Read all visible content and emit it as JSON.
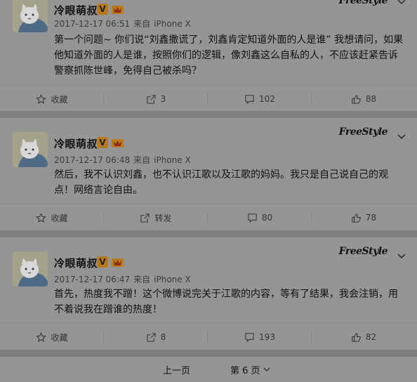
{
  "posts": [
    {
      "username": "冷眼萌叔",
      "timestamp": "2017-12-17 06:51",
      "source_prefix": "来自",
      "source": "iPhone X",
      "brand": "FreeStyle",
      "content": "第一个问题~ 你们说“刘鑫撒谎了，刘鑫肯定知道外面的人是谁” 我想请问，如果他知道外面的人是谁，按照你们的逻辑，像刘鑫这么自私的人，不应该赶紧告诉警察抓陈世峰，免得自己被杀吗？",
      "favorite_label": "收藏",
      "repost_label": "3",
      "comment_label": "102",
      "like_label": "88"
    },
    {
      "username": "冷眼萌叔",
      "timestamp": "2017-12-17 06:48",
      "source_prefix": "来自",
      "source": "iPhone X",
      "brand": "FreeStyle",
      "content": "然后，我不认识刘鑫，也不认识江歌以及江歌的妈妈。我只是自己说自己的观点！网络言论自由。",
      "favorite_label": "收藏",
      "repost_label": "转发",
      "comment_label": "80",
      "like_label": "78"
    },
    {
      "username": "冷眼萌叔",
      "timestamp": "2017-12-17 06:47",
      "source_prefix": "来自",
      "source": "iPhone X",
      "brand": "FreeStyle",
      "content": "首先，热度我不蹭！这个微博说完关于江歌的内容，等有了结果，我会注销，用不着说我在蹭谁的热度！",
      "favorite_label": "收藏",
      "repost_label": "8",
      "comment_label": "193",
      "like_label": "82"
    }
  ],
  "pagination": {
    "prev_label": "上一页",
    "current_page_label": "第 6 页"
  },
  "colors": {
    "overlay_bg": "#959595",
    "gap_bg": "#7f7f7f",
    "vip_orange": "#b87a1f"
  }
}
